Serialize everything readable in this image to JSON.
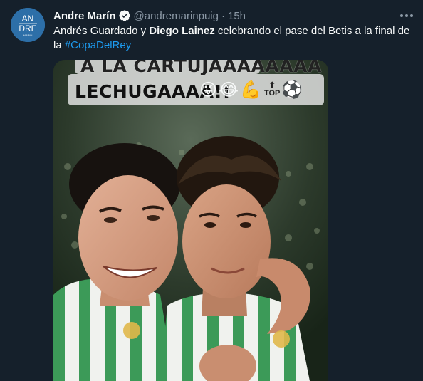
{
  "tweet": {
    "author_name": "Andre Marín",
    "handle": "@andremarinpuig",
    "separator": "·",
    "time": "15h",
    "avatar_monogram_line1": "AN",
    "avatar_monogram_line2": "DRE",
    "avatar_monogram_line3": "MARIN",
    "text_part1": "Andrés Guardado y ",
    "text_bold": "Diego Lainez",
    "text_part2": " celebrando el pase del Betis a la final de la ",
    "hashtag": "#CopaDelRey"
  },
  "media": {
    "caption_line1": "A LA CARTUJAAAAAAAA",
    "caption_line2": "LECHUGAAAA!!",
    "emojis": [
      "😜",
      "😂",
      "💪"
    ],
    "top_label": "TOP",
    "top_arrow": "⬆",
    "ball_emoji": "⚽"
  },
  "icons": {
    "verified": "verified-badge-icon",
    "more": "more-icon"
  },
  "colors": {
    "background": "#15202b",
    "primary_text": "#f7f9f9",
    "secondary_text": "#8b98a5",
    "link": "#1d9bf0",
    "avatar_bg": "#2d6fa8"
  }
}
